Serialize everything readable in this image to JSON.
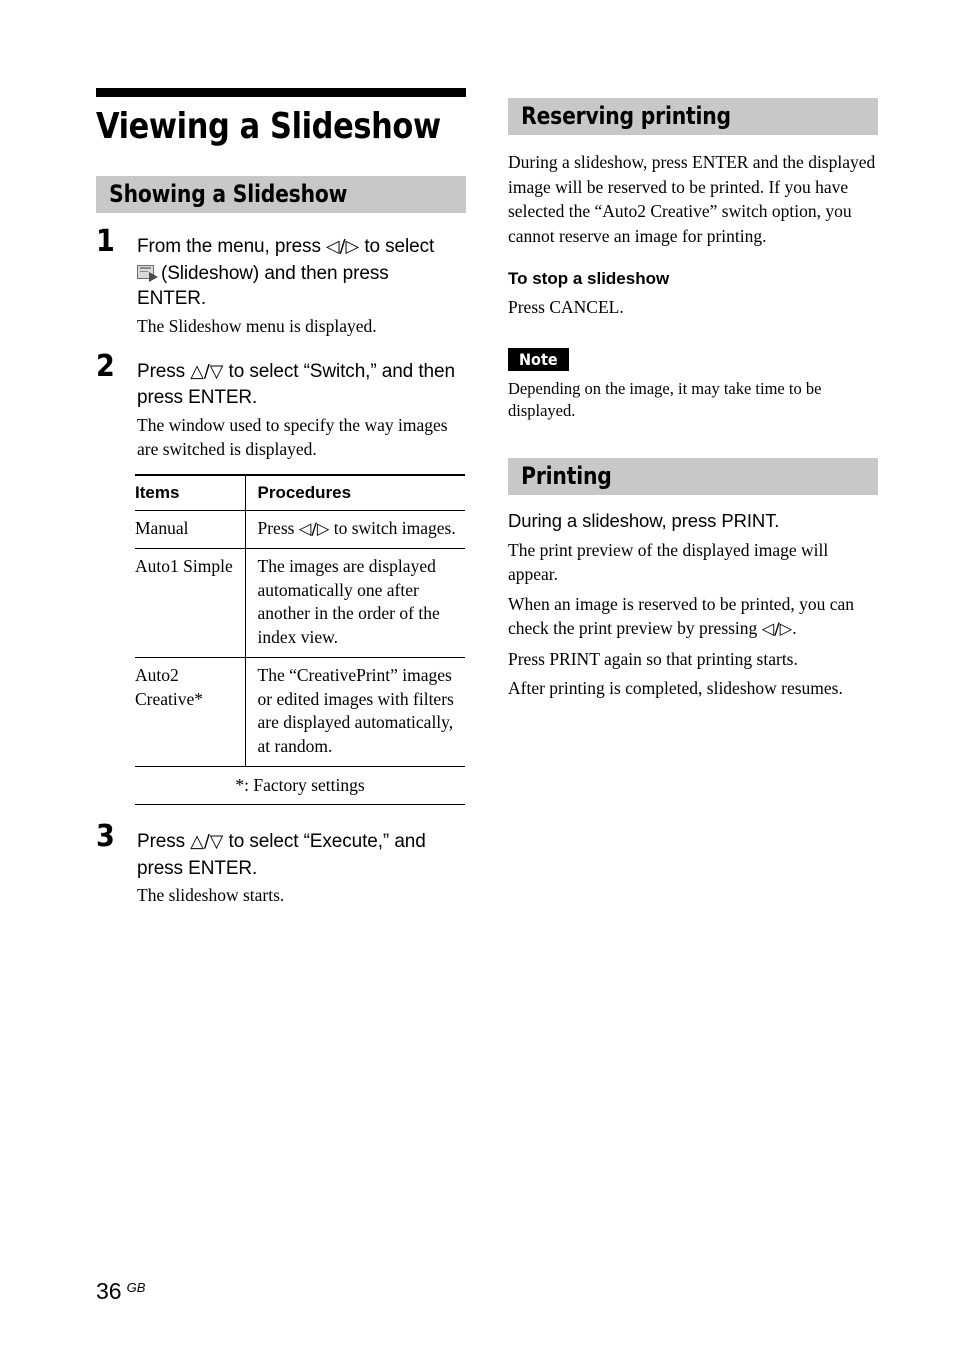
{
  "page": {
    "number": "36",
    "region": "GB"
  },
  "chapter": {
    "title": "Viewing a Slideshow"
  },
  "left_column": {
    "section": {
      "title": "Showing a Slideshow"
    },
    "steps": [
      {
        "number": "1",
        "head_before_icon": "From the menu, press ",
        "head_arrows": "◁/▷",
        "head_after_arrows": " to select",
        "icon": "slideshow-icon",
        "head_line2": "(Slideshow) and then press",
        "head_line3": "ENTER.",
        "body": "The Slideshow menu is displayed."
      },
      {
        "number": "2",
        "head_before": "Press ",
        "head_arrows": "△/▽",
        "head_after": " to select “Switch,” and then press ENTER.",
        "body": "The window used to specify the way images are switched is displayed."
      },
      {
        "number": "3",
        "head_before": "Press ",
        "head_arrows": "△/▽",
        "head_after": " to select “Execute,” and press ENTER.",
        "body": "The slideshow starts."
      }
    ],
    "table": {
      "headers": [
        "Items",
        "Procedures"
      ],
      "rows": [
        {
          "item": "Manual",
          "procedure_before": "Press ",
          "procedure_arrows": "◁/▷",
          "procedure_after": " to switch images."
        },
        {
          "item": "Auto1 Simple",
          "procedure_before": "The images are displayed automatically one after another in the order of the index view.",
          "procedure_arrows": "",
          "procedure_after": ""
        },
        {
          "item": "Auto2 Creative*",
          "procedure_before": "The “CreativePrint” images or edited images with filters are displayed automatically, at random.",
          "procedure_arrows": "",
          "procedure_after": ""
        }
      ],
      "footnote": "*: Factory settings"
    }
  },
  "right_column": {
    "reserving": {
      "title": "Reserving printing",
      "paragraph": "During a slideshow, press ENTER and the displayed image will be reserved to be printed. If you have selected the “Auto2 Creative” switch option, you cannot reserve an image for printing.",
      "sub_head": "To stop a slideshow",
      "sub_body": "Press CANCEL.",
      "note_label": "Note",
      "note_body": "Depending on the image, it may take time to be displayed."
    },
    "printing": {
      "title": "Printing",
      "lead": "During a slideshow, press PRINT.",
      "para1": "The print preview of the displayed image will appear.",
      "para2_before": "When an image is reserved to be printed, you can check the print preview by pressing ",
      "para2_arrows": "◁/▷",
      "para2_after": ".",
      "para3": "Press PRINT again so that printing starts.",
      "para4": "After printing is completed, slideshow resumes."
    }
  }
}
